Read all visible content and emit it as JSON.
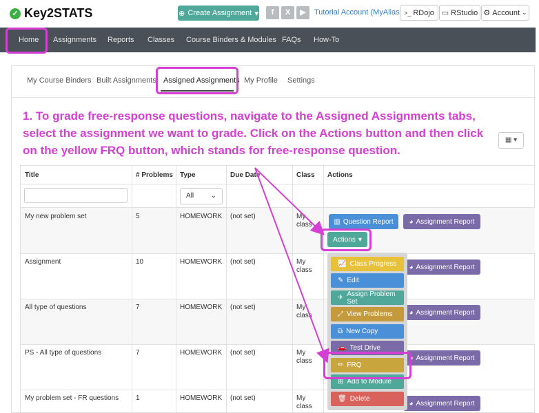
{
  "app": {
    "name": "Key2STATS"
  },
  "topbar": {
    "create_label": "Create Assignment",
    "social": [
      "f",
      "X",
      "▶"
    ],
    "account_name": "Tutorial Account (MyAlias)",
    "rdojo": "RDojo",
    "rstudio": "RStudio",
    "account": "Account"
  },
  "nav": {
    "items": [
      "Home",
      "Assignments",
      "Reports",
      "Classes",
      "Course Binders & Modules",
      "FAQs",
      "How-To"
    ]
  },
  "tabs": [
    "My Course Binders",
    "Built Assignments",
    "Assigned Assignments",
    "My Profile",
    "Settings"
  ],
  "instruction": "1. To grade free-response questions, navigate to the Assigned Assignments tabs, select the assignment we want to grade. Click on the Actions button and then click on the yellow FRQ button, which stands for free-response question.",
  "table": {
    "headers": [
      "Title",
      "# Problems",
      "Type",
      "Due Date",
      "Class",
      "Actions"
    ],
    "type_filter": "All",
    "rows": [
      {
        "title": "My new problem set",
        "problems": "5",
        "type": "HOMEWORK",
        "due": "(not set)",
        "class": "My class"
      },
      {
        "title": "Assignment",
        "problems": "10",
        "type": "HOMEWORK",
        "due": "(not set)",
        "class": "My class"
      },
      {
        "title": "All type of questions",
        "problems": "7",
        "type": "HOMEWORK",
        "due": "(not set)",
        "class": "My class"
      },
      {
        "title": "PS - All type of questions",
        "problems": "7",
        "type": "HOMEWORK",
        "due": "(not set)",
        "class": "My class"
      },
      {
        "title": "My problem set - FR questions",
        "problems": "1",
        "type": "HOMEWORK",
        "due": "(not set)",
        "class": "My class"
      }
    ]
  },
  "actions": {
    "question_report": "Question Report",
    "assignment_report": "Assignment Report",
    "actions_label": "Actions"
  },
  "menu": {
    "items": [
      {
        "label": "Class Progress",
        "icon": "chart-icon",
        "color": "#e8c13a"
      },
      {
        "label": "Edit",
        "icon": "edit-icon",
        "color": "#4a90d9"
      },
      {
        "label": "Assign Problem Set",
        "icon": "send-icon",
        "color": "#4fa89a"
      },
      {
        "label": "View Problems",
        "icon": "expand-icon",
        "color": "#c49a3c"
      },
      {
        "label": "New Copy",
        "icon": "copy-icon",
        "color": "#4a90d9"
      },
      {
        "label": "Test Drive",
        "icon": "car-icon",
        "color": "#7a6aa8"
      },
      {
        "label": "FRQ",
        "icon": "pencil-icon",
        "color": "#c9a53e"
      },
      {
        "label": "Add to Module",
        "icon": "plus-icon",
        "color": "#4fa89a"
      },
      {
        "label": "Delete",
        "icon": "trash-icon",
        "color": "#d9625c"
      }
    ]
  },
  "colors": {
    "annotation": "#d63fd3",
    "navbar": "#4a5057",
    "teal": "#4fa89a"
  }
}
